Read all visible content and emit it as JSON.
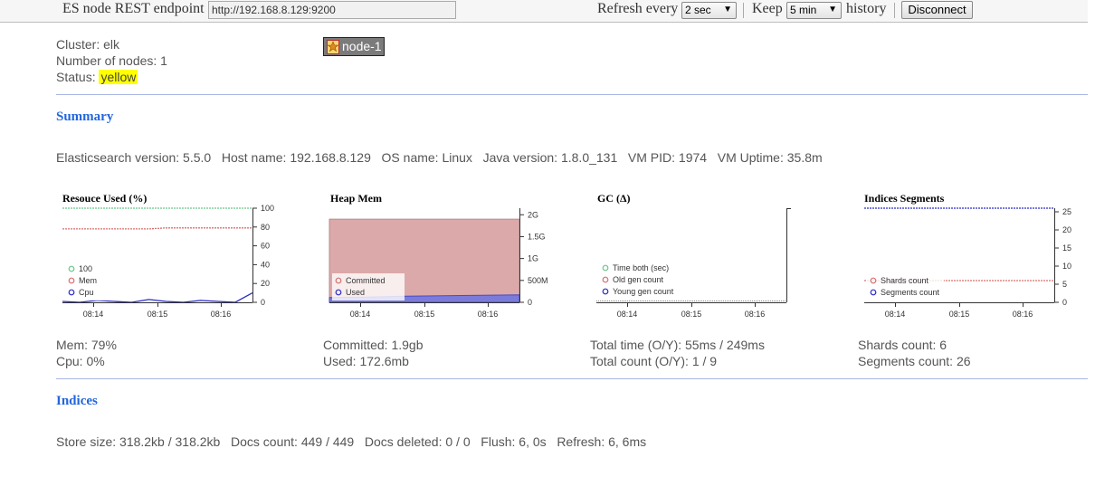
{
  "toolbar": {
    "endpoint_label": "ES node REST endpoint",
    "endpoint_value": "http://192.168.8.129:9200",
    "refresh_label": "Refresh every",
    "refresh_value": "2 sec",
    "keep_label": "Keep",
    "keep_value": "5 min",
    "history_label": "history",
    "disconnect_label": "Disconnect"
  },
  "cluster": {
    "cluster_text": "Cluster: elk",
    "nodes_text": "Number of nodes: 1",
    "status_label": "Status:",
    "status_value": "yellow",
    "node_name": "node-1"
  },
  "summary": {
    "title": "Summary",
    "info_line": "Elasticsearch version: 5.5.0   Host name: 192.168.8.129   OS name: Linux   Java version: 1.8.0_131   VM PID: 1974   VM Uptime: 35.8m"
  },
  "indices": {
    "title": "Indices",
    "info_line": "Store size: 318.2kb / 318.2kb   Docs count: 449 / 449   Docs deleted: 0 / 0   Flush: 6, 0s   Refresh: 6, 6ms"
  },
  "colors": {
    "green": "#6ac78a",
    "red": "#d96f6f",
    "blue": "#2a2acc",
    "heap_fill": "#dba9a9",
    "heap_used": "#7b7bdc",
    "link": "#2266dd"
  },
  "chart_data": [
    {
      "type": "line",
      "title": "Resouce Used (%)",
      "x_ticks": [
        "08:14",
        "08:15",
        "08:16"
      ],
      "y_ticks": [
        "100",
        "80",
        "60",
        "40",
        "20",
        "0"
      ],
      "ylim": [
        0,
        100
      ],
      "legend": [
        "100",
        "Mem",
        "Cpu"
      ],
      "series": [
        {
          "name": "100",
          "color": "#6ac78a",
          "values": [
            100,
            100,
            100,
            100,
            100,
            100,
            100,
            100,
            100,
            100,
            100,
            100
          ]
        },
        {
          "name": "Mem",
          "color": "#d96f6f",
          "values": [
            78,
            78,
            78,
            78,
            78,
            78,
            79,
            79,
            79,
            79,
            79,
            79
          ]
        },
        {
          "name": "Cpu",
          "color": "#2a2acc",
          "values": [
            1,
            0,
            2,
            1,
            0,
            3,
            1,
            0,
            2,
            1,
            0,
            10
          ]
        }
      ],
      "footer": [
        "Mem: 79%",
        "Cpu: 0%"
      ]
    },
    {
      "type": "area",
      "title": "Heap Mem",
      "x_ticks": [
        "08:14",
        "08:15",
        "08:16"
      ],
      "y_ticks": [
        "2G",
        "1.5G",
        "1G",
        "500M",
        "0"
      ],
      "legend": [
        "Committed",
        "Used"
      ],
      "series": [
        {
          "name": "Committed",
          "color": "#dba9a9",
          "values": [
            1.9,
            1.9,
            1.9,
            1.9,
            1.9,
            1.9
          ]
        },
        {
          "name": "Used",
          "color": "#7b7bdc",
          "values": [
            0.11,
            0.12,
            0.14,
            0.15,
            0.16,
            0.17
          ]
        }
      ],
      "footer": [
        "Committed: 1.9gb",
        "Used: 172.6mb"
      ]
    },
    {
      "type": "line",
      "title": "GC (Δ)",
      "x_ticks": [
        "08:14",
        "08:15",
        "08:16"
      ],
      "legend": [
        "Time both (sec)",
        "Old gen count",
        "Young gen count"
      ],
      "series": [
        {
          "name": "Time both (sec)",
          "color": "#6ac78a",
          "values": []
        },
        {
          "name": "Old gen count",
          "color": "#d96f6f",
          "values": []
        },
        {
          "name": "Young gen count",
          "color": "#2a2acc",
          "values": []
        }
      ],
      "footer": [
        "Total time (O/Y): 55ms / 249ms",
        "Total count (O/Y): 1 / 9"
      ]
    },
    {
      "type": "line",
      "title": "Indices Segments",
      "x_ticks": [
        "08:14",
        "08:15",
        "08:16"
      ],
      "y_ticks": [
        "25",
        "20",
        "15",
        "10",
        "5",
        "0"
      ],
      "ylim": [
        0,
        25
      ],
      "legend": [
        "Shards count",
        "Segments count"
      ],
      "series": [
        {
          "name": "Shards count",
          "color": "#d96f6f",
          "values": [
            6,
            6,
            6,
            6,
            6,
            6
          ]
        },
        {
          "name": "Segments count",
          "color": "#2a2acc",
          "values": [
            26,
            26,
            26,
            26,
            26,
            26
          ]
        }
      ],
      "footer": [
        "Shards count: 6",
        "Segments count: 26"
      ]
    }
  ]
}
